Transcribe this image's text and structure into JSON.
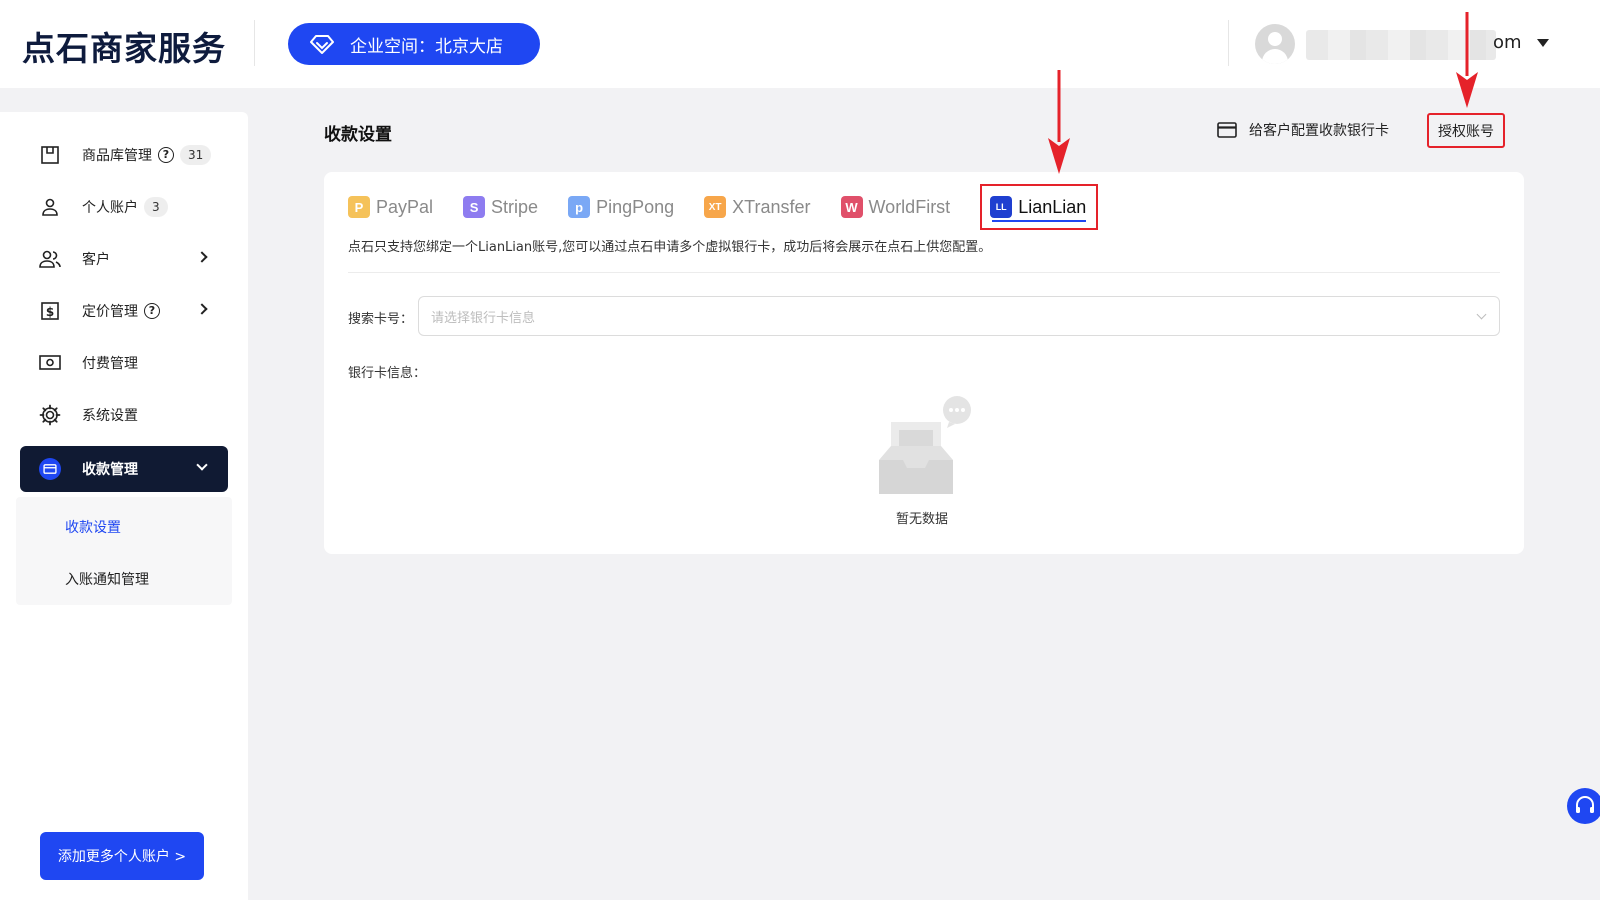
{
  "header": {
    "logo": "点石商家服务",
    "space_label": "企业空间：北京大店",
    "user_suffix": "om"
  },
  "sidebar": {
    "items": [
      {
        "label": "商品库管理",
        "badge": "31"
      },
      {
        "label": "个人账户",
        "badge": "3"
      },
      {
        "label": "客户"
      },
      {
        "label": "定价管理"
      },
      {
        "label": "付费管理"
      },
      {
        "label": "系统设置"
      },
      {
        "label": "收款管理"
      }
    ],
    "sub_items": [
      {
        "label": "收款设置"
      },
      {
        "label": "入账通知管理"
      }
    ],
    "add_button": "添加更多个人账户 >"
  },
  "main": {
    "title": "收款设置",
    "config_link": "给客户配置收款银行卡",
    "auth_button": "授权账号",
    "tabs": [
      {
        "label": "PayPal",
        "color": "#f5c25a",
        "glyph": "P"
      },
      {
        "label": "Stripe",
        "color": "#8e7cf0",
        "glyph": "S"
      },
      {
        "label": "PingPong",
        "color": "#7aa8f5",
        "glyph": "p"
      },
      {
        "label": "XTransfer",
        "color": "#f7a64a",
        "glyph": "XT"
      },
      {
        "label": "WorldFirst",
        "color": "#e0506a",
        "glyph": "W"
      },
      {
        "label": "LianLian",
        "color": "#1f3fd0",
        "glyph": "LL"
      }
    ],
    "notice": "点石只支持您绑定一个LianLian账号,您可以通过点石申请多个虚拟银行卡，成功后将会展示在点石上供您配置。",
    "search_label": "搜索卡号：",
    "search_placeholder": "请选择银行卡信息",
    "bank_info_label": "银行卡信息：",
    "empty_text": "暂无数据"
  },
  "colors": {
    "primary": "#1f47f2",
    "highlight": "#e5222a",
    "sidebar_active": "#101a33"
  }
}
